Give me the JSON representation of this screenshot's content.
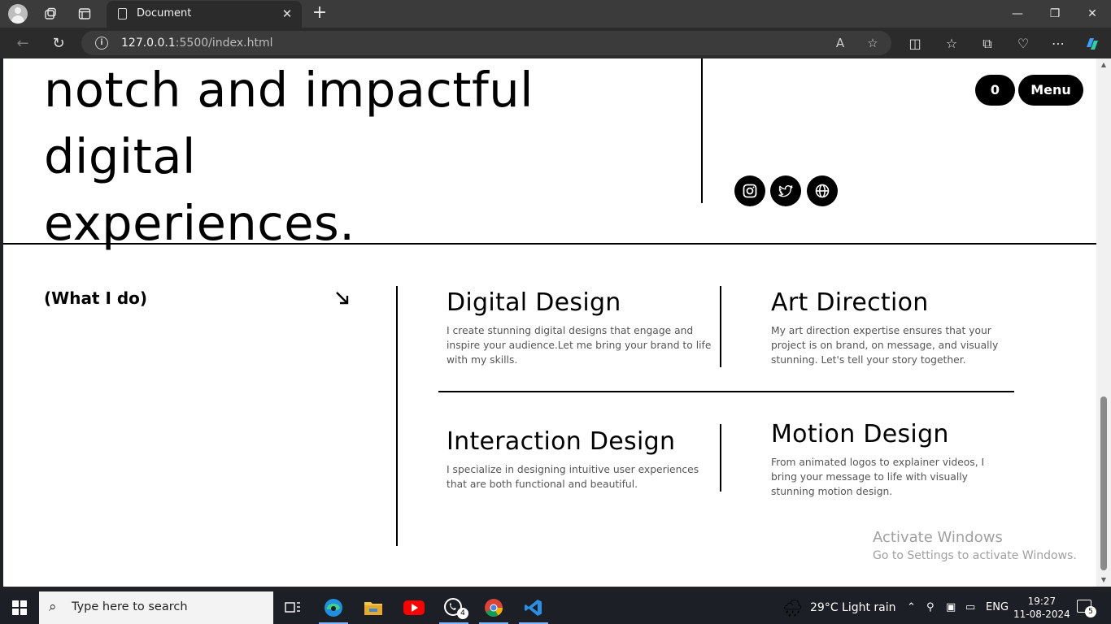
{
  "browser": {
    "tab_title": "Document",
    "url_host": "127.0.0.1",
    "url_path": ":5500/index.html"
  },
  "page": {
    "hero_line1": "notch and impactful digital",
    "hero_line2": "experiences.",
    "cart_count": "0",
    "menu_label": "Menu",
    "section_label": "(What I do)",
    "services": [
      {
        "title": "Digital Design",
        "desc": "I create stunning digital designs that engage and inspire your audience.Let me bring your brand to life with my skills."
      },
      {
        "title": "Art Direction",
        "desc": "My art direction expertise ensures that your project is on brand, on message, and visually stunning. Let's tell your story together."
      },
      {
        "title": "Interaction Design",
        "desc": "I specialize in designing intuitive user experiences that are both functional and beautiful."
      },
      {
        "title": "Motion Design",
        "desc": "From animated logos to explainer videos, I bring your message to life with visually stunning motion design."
      }
    ],
    "social_icons": [
      "instagram-icon",
      "twitter-icon",
      "globe-icon"
    ]
  },
  "watermark": {
    "line1": "Activate Windows",
    "line2": "Go to Settings to activate Windows."
  },
  "taskbar": {
    "search_placeholder": "Type here to search",
    "whatsapp_badge": "4",
    "weather": "29°C  Light rain",
    "language": "ENG",
    "time": "19:27",
    "date": "11-08-2024",
    "notification_count": "5"
  }
}
